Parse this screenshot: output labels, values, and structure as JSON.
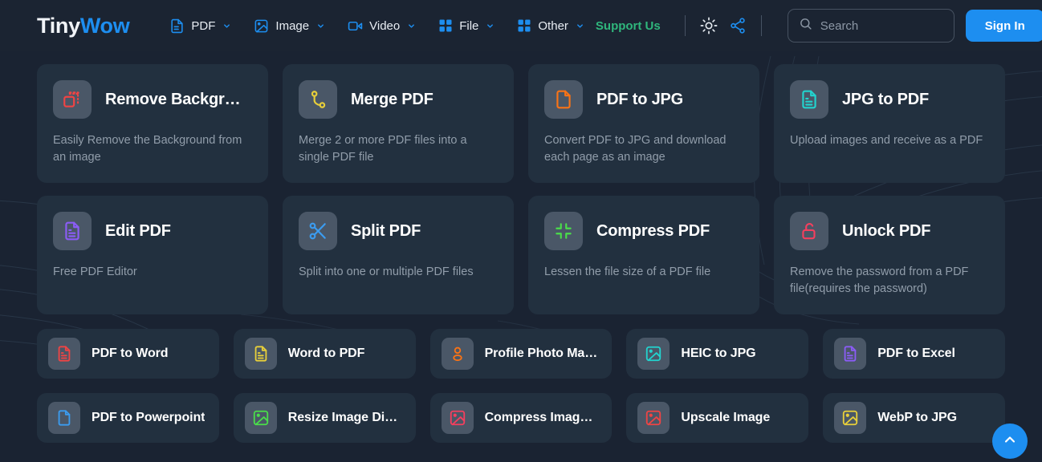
{
  "brand": {
    "part1": "Tiny",
    "part2": "Wow"
  },
  "nav": {
    "items": [
      {
        "label": "PDF",
        "icon": "document-icon",
        "caret": true
      },
      {
        "label": "Image",
        "icon": "image-icon",
        "caret": true
      },
      {
        "label": "Video",
        "icon": "video-icon",
        "caret": true
      },
      {
        "label": "File",
        "icon": "grid-icon",
        "caret": true
      },
      {
        "label": "Other",
        "icon": "grid-icon",
        "caret": true
      }
    ]
  },
  "header": {
    "support_label": "Support Us",
    "theme_icon": "sun-icon",
    "share_icon": "share-icon",
    "search_placeholder": "Search",
    "search_value": "",
    "signin_label": "Sign In"
  },
  "colors": {
    "accent_blue": "#1d8ef0",
    "support_green": "#2fb67c",
    "page_bg": "#1a2332",
    "card_bg": "#22303f",
    "tile_bg": "#4a5767",
    "title_text": "#ffffff",
    "desc_text": "#919daa"
  },
  "cards": [
    {
      "title": "Remove Backgr…",
      "desc": "Easily Remove the Background from an image",
      "icon": "remove-background-icon",
      "color": "#ef4444"
    },
    {
      "title": "Merge PDF",
      "desc": "Merge 2 or more PDF files into a single PDF file",
      "icon": "merge-icon",
      "color": "#e8cf3a"
    },
    {
      "title": "PDF to JPG",
      "desc": "Convert PDF to JPG and download each page as an image",
      "icon": "file-icon",
      "color": "#f97316"
    },
    {
      "title": "JPG to PDF",
      "desc": "Upload images and receive as a PDF",
      "icon": "document-lines-icon",
      "color": "#22d3ce"
    },
    {
      "title": "Edit PDF",
      "desc": "Free PDF Editor",
      "icon": "document-lines-icon",
      "color": "#8b5cf6"
    },
    {
      "title": "Split PDF",
      "desc": "Split into one or multiple PDF files",
      "icon": "scissors-icon",
      "color": "#3b9cf0"
    },
    {
      "title": "Compress PDF",
      "desc": "Lessen the file size of a PDF file",
      "icon": "compress-icon",
      "color": "#4ade4a"
    },
    {
      "title": "Unlock PDF",
      "desc": "Remove the password from a PDF file(requires the password)",
      "icon": "unlock-icon",
      "color": "#f43f5e"
    }
  ],
  "pills_row1": [
    {
      "label": "PDF to Word",
      "icon": "document-lines-icon",
      "color": "#ef4444"
    },
    {
      "label": "Word to PDF",
      "icon": "document-lines-icon",
      "color": "#e8cf3a"
    },
    {
      "label": "Profile Photo Ma…",
      "icon": "person-icon",
      "color": "#f97316"
    },
    {
      "label": "HEIC to JPG",
      "icon": "image-icon",
      "color": "#22d3ce"
    },
    {
      "label": "PDF to Excel",
      "icon": "document-lines-icon",
      "color": "#8b5cf6"
    }
  ],
  "pills_row2": [
    {
      "label": "PDF to Powerpoint",
      "icon": "file-icon",
      "color": "#3b9cf0"
    },
    {
      "label": "Resize Image Di…",
      "icon": "image-icon",
      "color": "#4ade4a"
    },
    {
      "label": "Compress Imag…",
      "icon": "image-icon",
      "color": "#f43f5e"
    },
    {
      "label": "Upscale Image",
      "icon": "image-icon",
      "color": "#ef4444"
    },
    {
      "label": "WebP to JPG",
      "icon": "image-icon",
      "color": "#e8cf3a"
    }
  ],
  "fab": {
    "icon": "chevron-up-icon",
    "label": "Scroll to top"
  }
}
